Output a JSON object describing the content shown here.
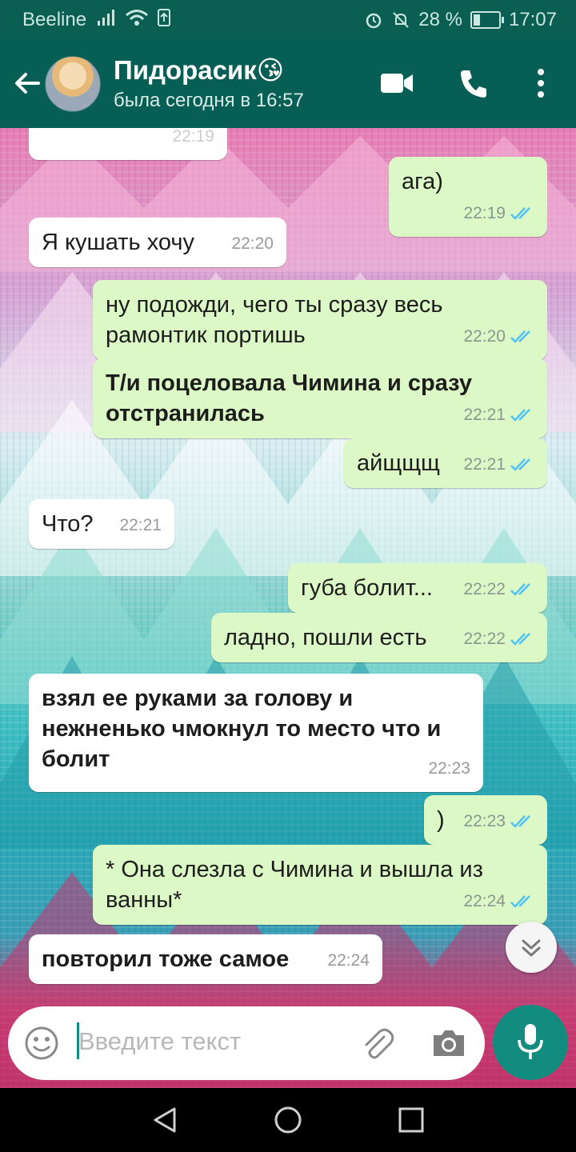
{
  "status_bar": {
    "carrier": "Beeline",
    "battery": "28 %",
    "battery_level": 0.28,
    "time": "17:07"
  },
  "header": {
    "contact_name": "Пидорасик😘",
    "contact_status": "была сегодня в 16:57"
  },
  "messages": [
    {
      "dir": "in",
      "text": "",
      "time": "22:19"
    },
    {
      "dir": "out",
      "text": "ага)",
      "time": "22:19",
      "read": true
    },
    {
      "dir": "in",
      "text": "Я кушать хочу",
      "time": "22:20"
    },
    {
      "dir": "out",
      "text": "ну подожди, чего ты сразу весь рамонтик портишь",
      "time": "22:20",
      "read": true
    },
    {
      "dir": "out",
      "text": "Т/и поцеловала Чимина и сразу отстранилась",
      "time": "22:21",
      "read": true,
      "bold": true
    },
    {
      "dir": "out",
      "text": "айщщщ",
      "time": "22:21",
      "read": true
    },
    {
      "dir": "in",
      "text": "Что?",
      "time": "22:21"
    },
    {
      "dir": "out",
      "text": "губа болит...",
      "time": "22:22",
      "read": true
    },
    {
      "dir": "out",
      "text": "ладно, пошли есть",
      "time": "22:22",
      "read": true
    },
    {
      "dir": "in",
      "text": "взял ее руками за голову и нежненько чмокнул то место что и болит",
      "time": "22:23",
      "bold": true
    },
    {
      "dir": "out",
      "text": ")",
      "time": "22:23",
      "read": true
    },
    {
      "dir": "out",
      "text": "* Она слезла с Чимина и вышла из ванны*",
      "time": "22:24",
      "read": true
    },
    {
      "dir": "in",
      "text": "повторил тоже самое",
      "time": "22:24",
      "bold": true
    }
  ],
  "input": {
    "placeholder": "Введите текст"
  },
  "icons": {
    "back": "arrow-left-icon",
    "video": "video-call-icon",
    "call": "phone-icon",
    "menu": "more-vert-icon",
    "emoji": "emoji-icon",
    "attach": "paperclip-icon",
    "camera": "camera-icon",
    "mic": "mic-icon",
    "scroll": "double-chevron-down-icon"
  },
  "colors": {
    "header": "#075e54",
    "bubble_out": "#dcf8c6",
    "bubble_in": "#ffffff",
    "accent": "#128c7e",
    "read_tick": "#4fc3f7"
  }
}
